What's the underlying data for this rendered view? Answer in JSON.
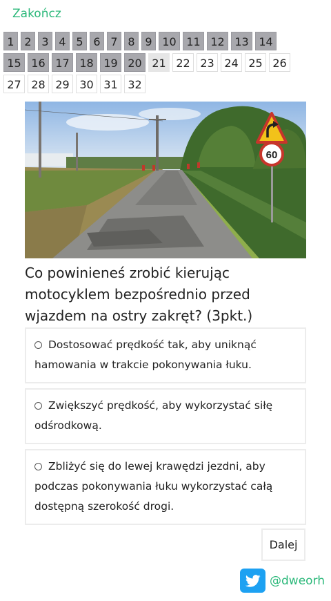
{
  "header": {
    "finish_label": "Zakończ"
  },
  "nav": {
    "rows": [
      [
        {
          "label": "1",
          "state": "done"
        },
        {
          "label": "2",
          "state": "done"
        },
        {
          "label": "3",
          "state": "done"
        },
        {
          "label": "4",
          "state": "done"
        },
        {
          "label": "5",
          "state": "done"
        },
        {
          "label": "6",
          "state": "done"
        },
        {
          "label": "7",
          "state": "done"
        },
        {
          "label": "8",
          "state": "done"
        },
        {
          "label": "9",
          "state": "done"
        },
        {
          "label": "10",
          "state": "done"
        },
        {
          "label": "11",
          "state": "done"
        },
        {
          "label": "12",
          "state": "done"
        },
        {
          "label": "13",
          "state": "done"
        },
        {
          "label": "14",
          "state": "done"
        }
      ],
      [
        {
          "label": "15",
          "state": "done"
        },
        {
          "label": "16",
          "state": "done"
        },
        {
          "label": "17",
          "state": "done"
        },
        {
          "label": "18",
          "state": "done"
        },
        {
          "label": "19",
          "state": "done"
        },
        {
          "label": "20",
          "state": "done"
        },
        {
          "label": "21",
          "state": "current"
        },
        {
          "label": "22",
          "state": "todo"
        },
        {
          "label": "23",
          "state": "todo"
        },
        {
          "label": "24",
          "state": "todo"
        },
        {
          "label": "25",
          "state": "todo"
        },
        {
          "label": "26",
          "state": "todo"
        }
      ],
      [
        {
          "label": "27",
          "state": "todo"
        },
        {
          "label": "28",
          "state": "todo"
        },
        {
          "label": "29",
          "state": "todo"
        },
        {
          "label": "30",
          "state": "todo"
        },
        {
          "label": "31",
          "state": "todo"
        },
        {
          "label": "32",
          "state": "todo"
        }
      ]
    ]
  },
  "question": {
    "text": "Co powinieneś zrobić kierując motocyklem bezpośrednio przed wjazdem na ostry zakręt? (3pkt.)",
    "sign_speed": "60"
  },
  "answers": [
    {
      "text": "Dostosować prędkość tak, aby uniknąć hamowania w trakcie pokonywania łuku."
    },
    {
      "text": "Zwiększyć prędkość, aby wykorzystać siłę odśrodkową."
    },
    {
      "text": "Zbliżyć się do lewej krawędzi jezdni, aby podczas pokonywania łuku wykorzystać całą dostępną szerokość drogi."
    }
  ],
  "footer": {
    "next_label": "Dalej",
    "twitter_handle": "@dweorh"
  },
  "colors": {
    "accent": "#2bb87a",
    "done_tile": "#a8a8ad",
    "current_tile": "#e6e6e6",
    "twitter": "#1da1f2"
  }
}
